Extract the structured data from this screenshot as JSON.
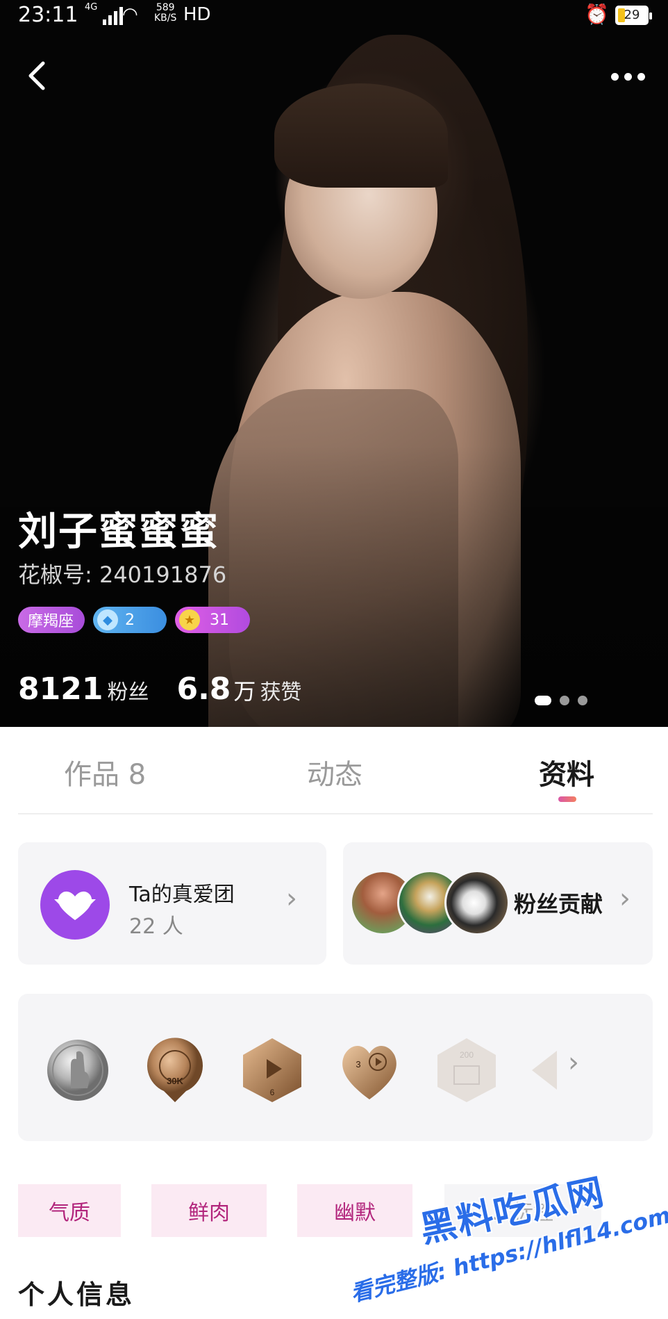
{
  "status_bar": {
    "time": "23:11",
    "network": "4G",
    "speed_value": "589",
    "speed_unit": "KB/S",
    "hd": "HD",
    "battery": "29"
  },
  "profile": {
    "name": "刘子蜜蜜蜜",
    "id_label": "花椒号: 240191876",
    "tags": {
      "zodiac": "摩羯座",
      "diamond_level": "2",
      "star_level": "31"
    },
    "stats": {
      "fans_value": "8121",
      "fans_label": "粉丝",
      "likes_value": "6.8",
      "likes_unit": "万",
      "likes_label": "获赞"
    },
    "carousel_pages": 3,
    "carousel_active": 1
  },
  "tabs": [
    {
      "label": "作品 8"
    },
    {
      "label": "动态"
    },
    {
      "label": "资料"
    }
  ],
  "fan_club": {
    "title": "Ta的真爱团",
    "count": "22 人"
  },
  "contribution": {
    "label": "粉丝贡献"
  },
  "medals": {
    "m2_text": "30K",
    "m3_text": "6",
    "m4_text": "3",
    "m5_text": "200"
  },
  "personality_tags": [
    {
      "label": "气质"
    },
    {
      "label": "鲜肉"
    },
    {
      "label": "幽默"
    },
    {
      "label": "…标签"
    }
  ],
  "section": {
    "personal_info": "个人信息"
  },
  "watermark": {
    "title": "黑料吃瓜网",
    "url": "看完整版: https://hlfl14.com"
  },
  "colors": {
    "accent_purple": "#9d49e8",
    "tag_pink_bg": "#fbeaf3",
    "tag_pink_text": "#b2257c",
    "tab_indicator": "#d957a7"
  }
}
